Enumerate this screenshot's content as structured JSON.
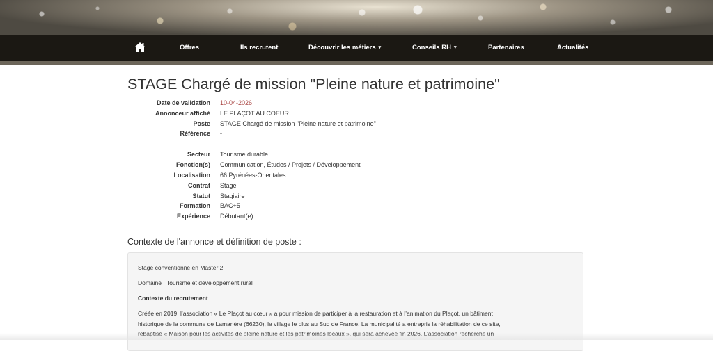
{
  "nav": {
    "home_icon": "home-icon",
    "items": [
      {
        "label": "Offres",
        "dropdown": false
      },
      {
        "label": "Ils recrutent",
        "dropdown": false
      },
      {
        "label": "Découvrir les métiers",
        "dropdown": true
      },
      {
        "label": "Conseils RH",
        "dropdown": true
      },
      {
        "label": "Partenaires",
        "dropdown": false
      },
      {
        "label": "Actualités",
        "dropdown": false
      }
    ],
    "caret": "▾"
  },
  "job": {
    "title": "STAGE Chargé de mission \"Pleine nature et patrimoine\"",
    "details": [
      {
        "label": "Date de validation",
        "value": "10-04-2026"
      },
      {
        "label": "Annonceur affiché",
        "value": "LE PLAÇOT AU COEUR"
      },
      {
        "label": "Poste",
        "value": "STAGE Chargé de mission \"Pleine nature et patrimoine\""
      },
      {
        "label": "Référence",
        "value": "-"
      }
    ],
    "attributes": [
      {
        "label": "Secteur",
        "value": "Tourisme durable"
      },
      {
        "label": "Fonction(s)",
        "value": "Communication, Études / Projets / Développement"
      },
      {
        "label": "Localisation",
        "value": "66 Pyrénées-Orientales"
      },
      {
        "label": "Contrat",
        "value": "Stage"
      },
      {
        "label": "Statut",
        "value": "Stagiaire"
      },
      {
        "label": "Formation",
        "value": "BAC+5"
      },
      {
        "label": "Expérience",
        "value": "Débutant(e)"
      }
    ]
  },
  "description": {
    "section_title": "Contexte de l'annonce et définition de poste :",
    "line1": "Stage conventionné en Master 2",
    "line2": "Domaine : Tourisme et développement rural",
    "heading": "Contexte du recrutement",
    "paragraph": [
      "Créée en 2019, l’association « Le Plaçot au cœur » a pour mission de participer à la restauration et à l’animation du Plaçot, un bâtiment",
      "historique de la commune de Lamanère (66230), le village le plus au Sud de France. La municipalité a entrepris la réhabilitation de ce site,",
      "rebaptisé « Maison pour les activités de pleine nature et les patrimoines locaux », qui sera achevée fin 2026.  L’association recherche un"
    ]
  },
  "colors": {
    "navbar_bg": "#1b1813",
    "date_red": "#a94442",
    "box_bg": "#f5f5f5"
  }
}
